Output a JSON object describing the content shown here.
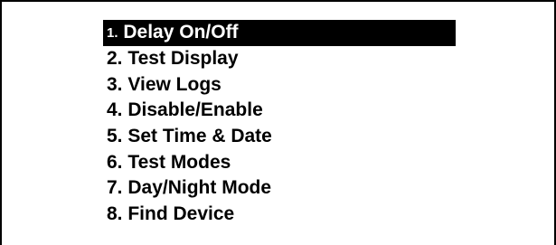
{
  "menu": {
    "items": [
      {
        "number": "1.",
        "label": "Delay On/Off",
        "selected": true
      },
      {
        "number": "2.",
        "label": "Test Display"
      },
      {
        "number": "3.",
        "label": "View Logs"
      },
      {
        "number": "4.",
        "label": "Disable/Enable"
      },
      {
        "number": "5.",
        "label": "Set Time & Date"
      },
      {
        "number": "6.",
        "label": "Test Modes"
      },
      {
        "number": "7.",
        "label": "Day/Night Mode"
      },
      {
        "number": "8.",
        "label": "Find Device"
      }
    ]
  },
  "colors": {
    "background": "#ffffff",
    "text": "#000000",
    "highlight": "#000000",
    "highlight_text": "#ffffff"
  }
}
